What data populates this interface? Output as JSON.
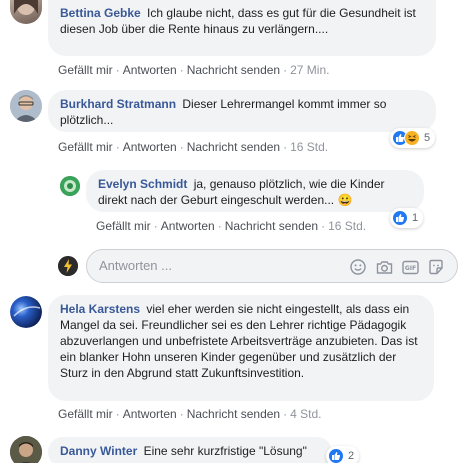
{
  "comments": [
    {
      "author": "Bettina Gebke",
      "text": "Ich glaube nicht, dass es gut für die Gesundheit ist diesen Job über die Rente hinaus zu verlängern....",
      "like": "Gefällt mir",
      "reply": "Antworten",
      "message": "Nachricht senden",
      "time": "27 Min."
    },
    {
      "author": "Burkhard Stratmann",
      "text": "Dieser Lehrermangel kommt immer so plötzlich...",
      "like": "Gefällt mir",
      "reply": "Antworten",
      "message": "Nachricht senden",
      "time": "16 Std.",
      "reaction_count": "5",
      "reply_comment": {
        "author": "Evelyn Schmidt",
        "text": "ja, genauso plötzlich, wie die Kinder direkt nach der Geburt eingeschult werden... 😀",
        "like": "Gefällt mir",
        "reply": "Antworten",
        "message": "Nachricht senden",
        "time": "16 Std.",
        "reaction_count": "1"
      },
      "reply_box": {
        "placeholder": "Antworten ..."
      }
    },
    {
      "author": "Hela Karstens",
      "text": "viel eher werden sie nicht eingestellt, als dass ein Mangel da sei. Freundlicher sei es den Lehrer richtige Pädagogik abzuverlangen und unbefristete Arbeitsverträge anzubieten. Das ist ein blanker Hohn unseren Kinder gegenüber und zusätzlich der Sturz in den Abgrund statt Zukunftsinvestition.",
      "like": "Gefällt mir",
      "reply": "Antworten",
      "message": "Nachricht senden",
      "time": "4 Std."
    },
    {
      "author": "Danny Winter",
      "text": "Eine sehr kurzfristige \"Lösung\"",
      "reaction_count": "2"
    }
  ],
  "colors": {
    "link": "#385898",
    "bubble": "#f2f3f5",
    "like_blue": "#2078f4",
    "meta": "#606770"
  },
  "icons": [
    "smiley-icon",
    "camera-icon",
    "gif-icon",
    "sticker-icon",
    "like-reaction-icon",
    "haha-reaction-icon"
  ]
}
